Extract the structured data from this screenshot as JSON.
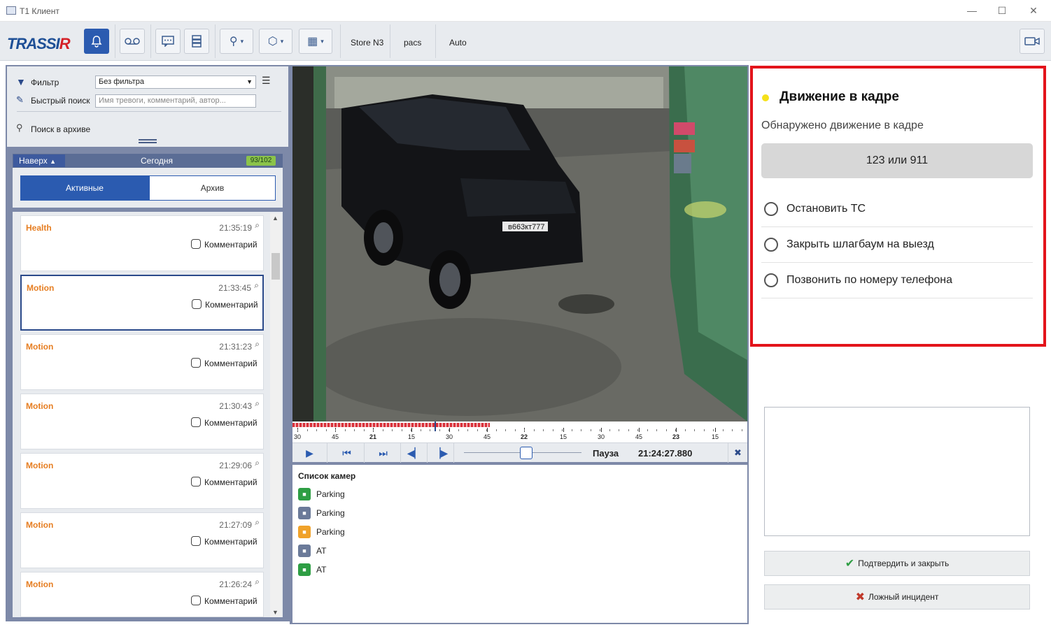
{
  "window": {
    "title": "T1 Клиент",
    "minimize": "—",
    "maximize": "☐",
    "close": "✕"
  },
  "toolbar": {
    "logo": "TRASSIR",
    "logo_accent": "R",
    "tabs": [
      "Store N3",
      "pacs",
      "Auto"
    ]
  },
  "filters": {
    "filter_label": "Фильтр",
    "filter_value": "Без фильтра",
    "search_label": "Быстрый поиск",
    "search_placeholder": "Имя тревоги, комментарий, автор...",
    "archive_search_label": "Поиск в архиве"
  },
  "events_header": {
    "up_label": "Наверх",
    "period": "Сегодня",
    "count": "93/102"
  },
  "segments": {
    "active": "Активные",
    "archive": "Архив"
  },
  "events": [
    {
      "type": "Health",
      "time": "21:35:19",
      "comment": "Комментарий"
    },
    {
      "type": "Motion",
      "time": "21:33:45",
      "comment": "Комментарий"
    },
    {
      "type": "Motion",
      "time": "21:31:23",
      "comment": "Комментарий"
    },
    {
      "type": "Motion",
      "time": "21:30:43",
      "comment": "Комментарий"
    },
    {
      "type": "Motion",
      "time": "21:29:06",
      "comment": "Комментарий"
    },
    {
      "type": "Motion",
      "time": "21:27:09",
      "comment": "Комментарий"
    },
    {
      "type": "Motion",
      "time": "21:26:24",
      "comment": "Комментарий"
    }
  ],
  "video": {
    "plate": "в663кт777"
  },
  "timeline": {
    "ticks": [
      "30",
      "45",
      "21",
      "15",
      "30",
      "45",
      "22",
      "15",
      "30",
      "45",
      "23",
      "15"
    ],
    "bold_ticks": [
      "21",
      "22",
      "23"
    ]
  },
  "player": {
    "state": "Пауза",
    "timestamp": "21:24:27.880",
    "close": "✖"
  },
  "camera_list": {
    "title": "Список камер",
    "cameras": [
      {
        "name": "Parking",
        "color": "#2e9e44"
      },
      {
        "name": "Parking",
        "color": "#6b7a99"
      },
      {
        "name": "Parking",
        "color": "#f0a22a"
      },
      {
        "name": "AT",
        "color": "#6b7a99"
      },
      {
        "name": "AT",
        "color": "#2e9e44"
      }
    ]
  },
  "incident": {
    "title": "Движение в кадре",
    "dot_color": "#f5e11a",
    "subtitle": "Обнаружено движение в кадре",
    "phone_button": "123 или 911",
    "options": [
      "Остановить ТС",
      "Закрыть шлагбаум на выезд",
      "Позвонить по номеру телефона"
    ],
    "confirm_button": "Подтвердить и закрыть",
    "false_button": "Ложный инцидент"
  },
  "colors": {
    "accent": "#2b5bb0",
    "alert_border": "#e3141b",
    "event_type": "#e67e22"
  }
}
